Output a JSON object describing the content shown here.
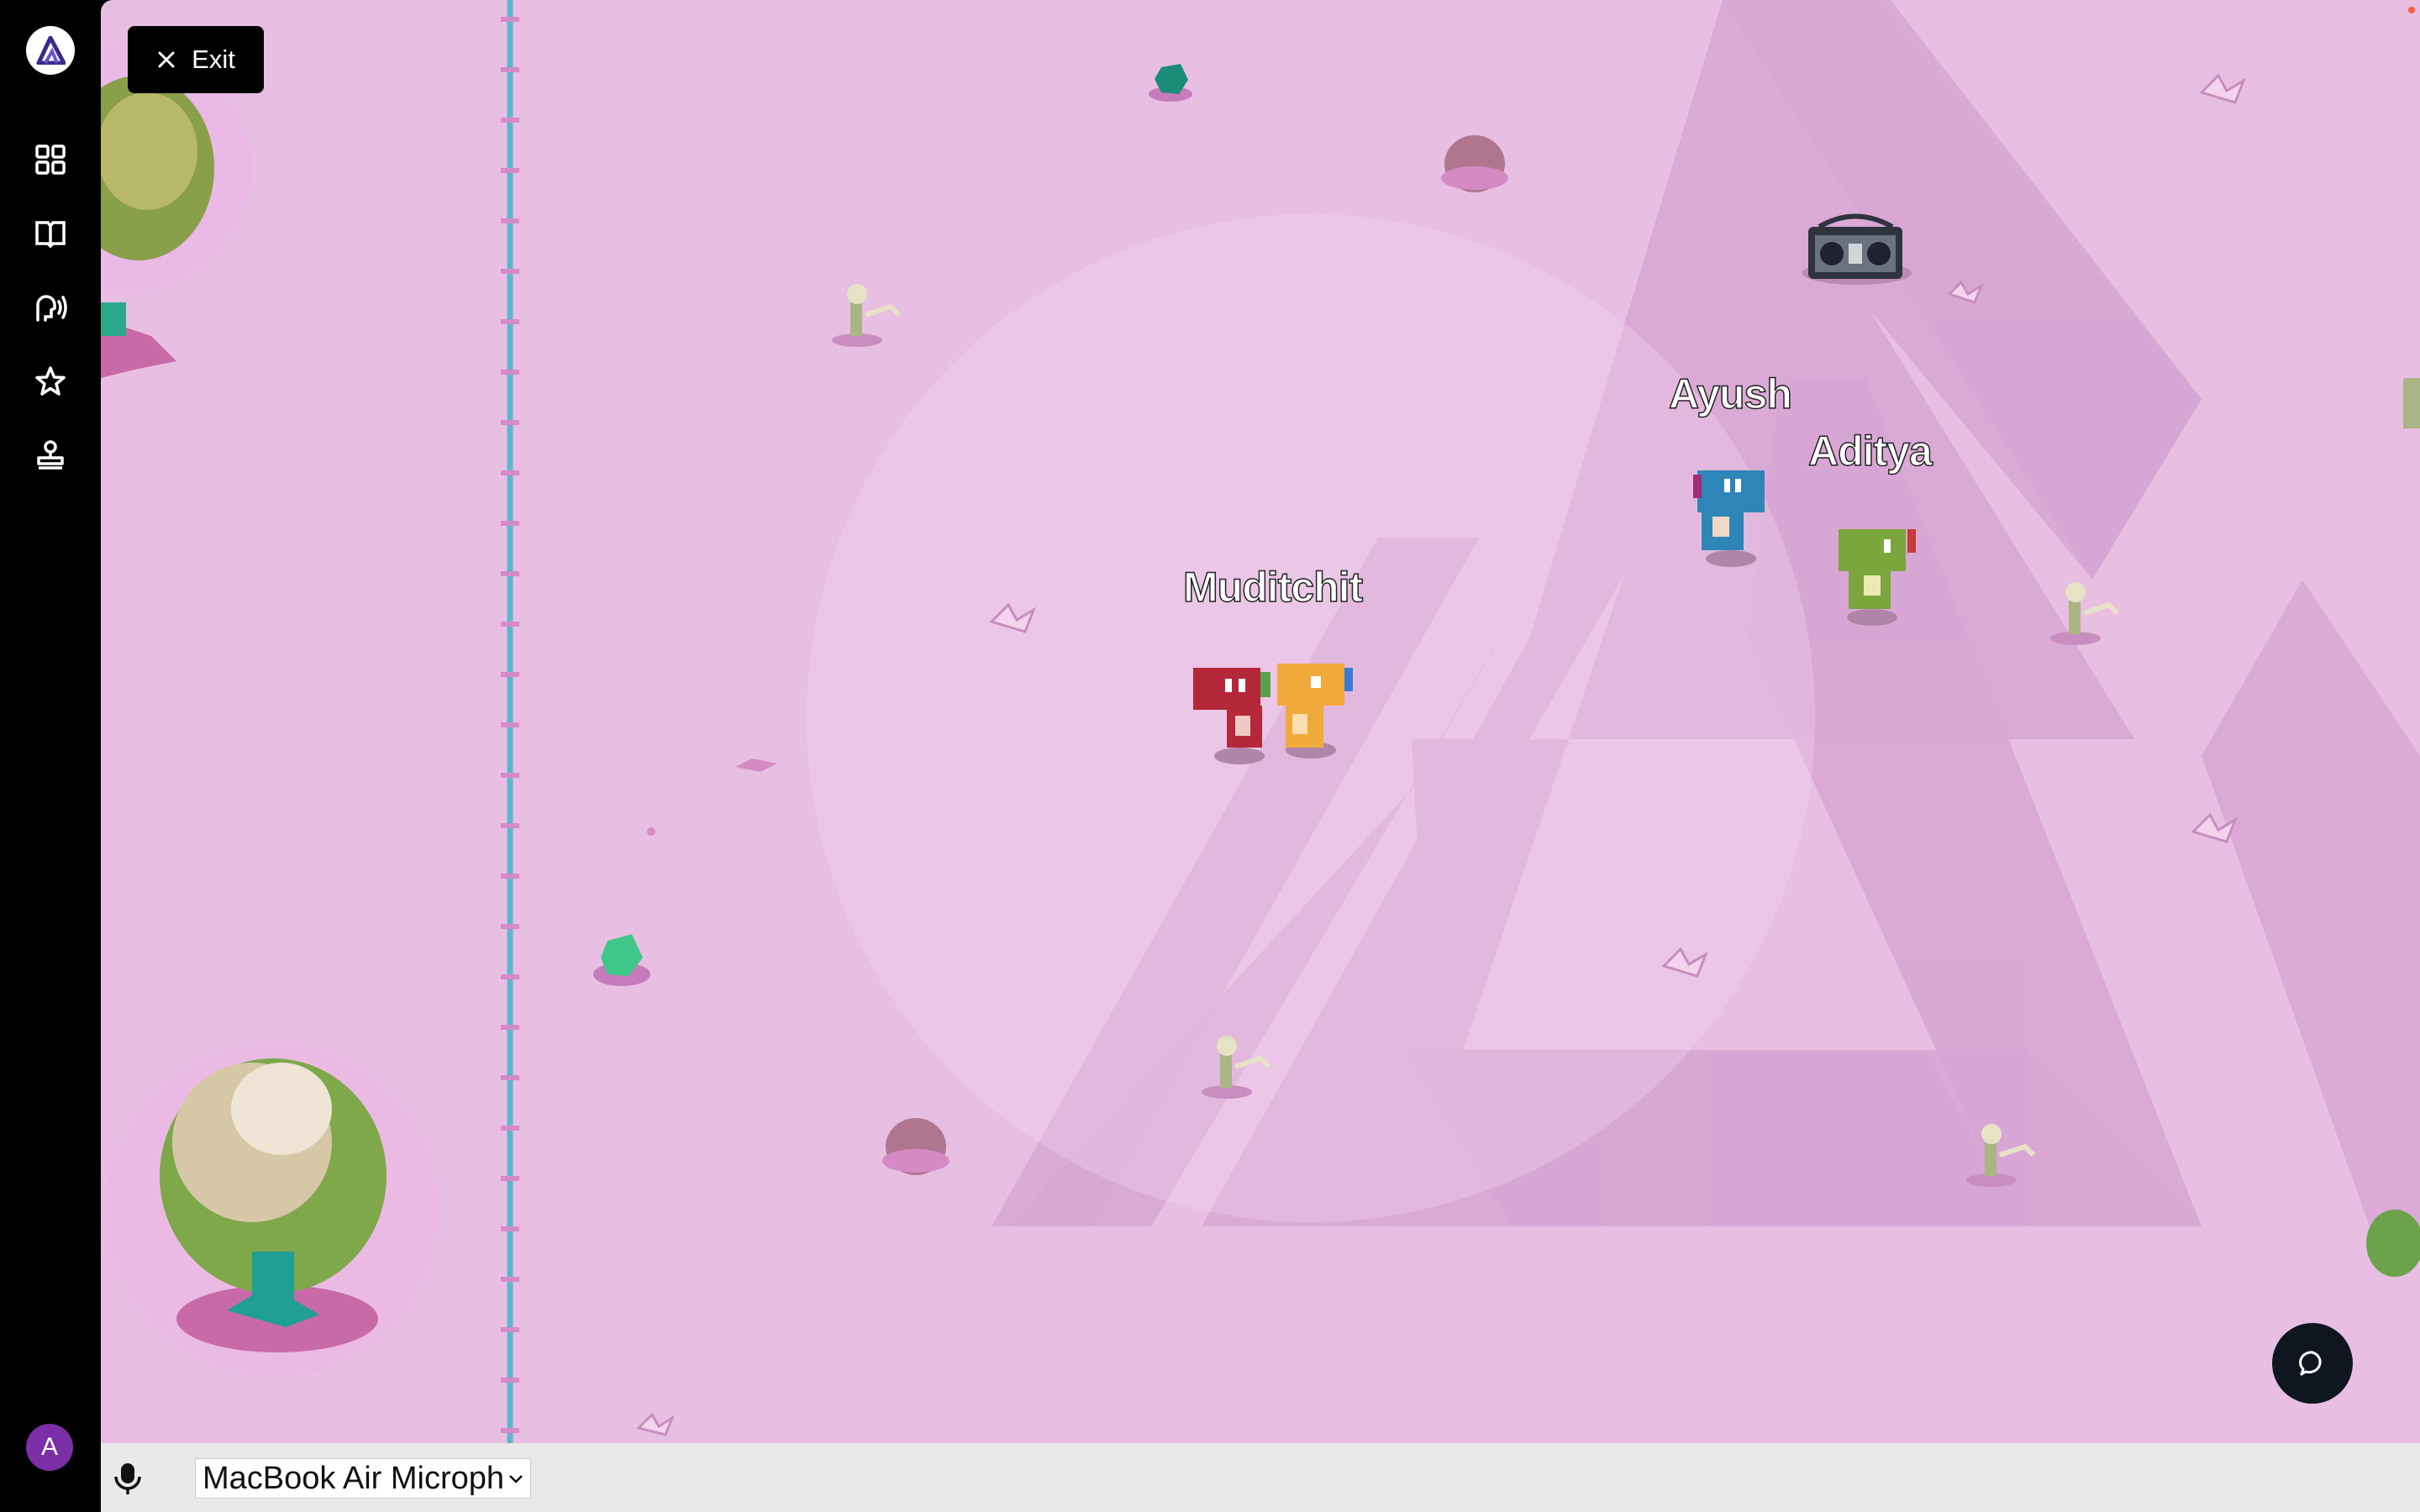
{
  "app": {
    "logo_icon": "app-logo-icon"
  },
  "sidebar": {
    "items": [
      {
        "name": "dashboard",
        "icon": "grid-icon"
      },
      {
        "name": "guide",
        "icon": "book-icon"
      },
      {
        "name": "audio",
        "icon": "speaking-head-icon"
      },
      {
        "name": "favorites",
        "icon": "star-icon"
      },
      {
        "name": "stamp",
        "icon": "stamp-icon"
      }
    ],
    "avatar_initial": "A",
    "avatar_color": "#7b2fa6"
  },
  "map": {
    "exit_label": "Exit",
    "background_color": "#e8bfe3",
    "players": [
      {
        "name": "Muditchit",
        "color": "red"
      },
      {
        "name": "Ayush",
        "color": "blue"
      },
      {
        "name": "Aditya",
        "color": "green"
      }
    ],
    "chat_icon": "chat-bubble-icon"
  },
  "bottom_bar": {
    "mic_icon": "microphone-icon",
    "mic_select_value": "MacBook Air Microph"
  }
}
